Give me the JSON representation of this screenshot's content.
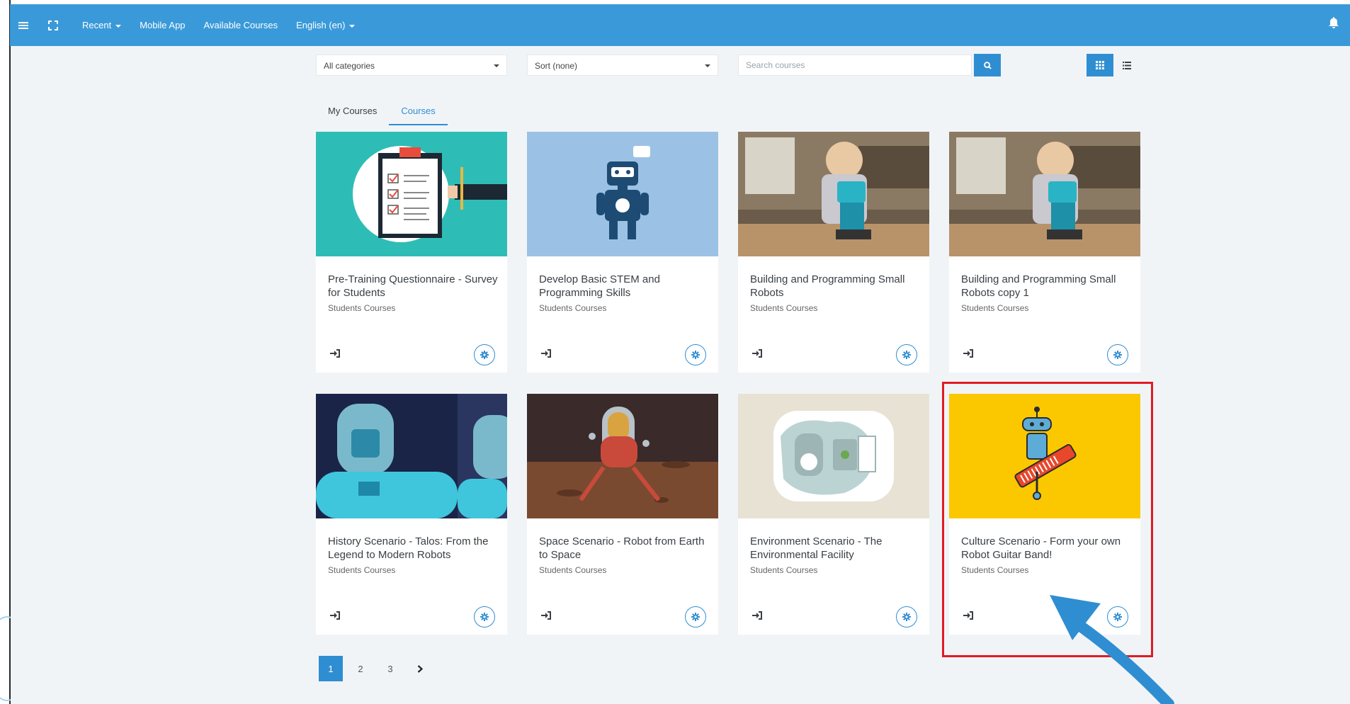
{
  "navbar": {
    "menu_icon": "hamburger-icon",
    "fullscreen_icon": "fullscreen-icon",
    "recent_label": "Recent",
    "mobile_app_label": "Mobile App",
    "available_courses_label": "Available Courses",
    "language_label": "English (en)",
    "bell_icon": "bell-icon"
  },
  "filters": {
    "category_value": "All categories",
    "sort_value": "Sort (none)",
    "search_placeholder": "Search courses",
    "search_icon": "search-icon",
    "grid_view_icon": "grid-view-icon",
    "list_view_icon": "list-view-icon"
  },
  "tabs": [
    {
      "label": "My Courses",
      "active": false
    },
    {
      "label": "Courses",
      "active": true
    }
  ],
  "courses": [
    {
      "title": "Pre-Training Questionnaire - Survey for Students",
      "category": "Students Courses",
      "image": "clipboard-checklist"
    },
    {
      "title": "Develop Basic STEM and Programming Skills",
      "category": "Students Courses",
      "image": "blue-robot-hi"
    },
    {
      "title": "Building and Programming Small Robots",
      "category": "Students Courses",
      "image": "child-with-robot-photo"
    },
    {
      "title": "Building and Programming Small Robots copy 1",
      "category": "Students Courses",
      "image": "child-with-robot-photo"
    },
    {
      "title": "History Scenario - Talos: From the Legend to Modern Robots",
      "category": "Students Courses",
      "image": "cyan-robots"
    },
    {
      "title": "Space Scenario - Robot from Earth to Space",
      "category": "Students Courses",
      "image": "space-robot-on-mars"
    },
    {
      "title": "Environment Scenario - The Environmental Facility",
      "category": "Students Courses",
      "image": "environmental-facility"
    },
    {
      "title": "Culture Scenario - Form your own Robot Guitar Band!",
      "category": "Students Courses",
      "image": "robot-with-keytar"
    }
  ],
  "pagination": {
    "pages": [
      "1",
      "2",
      "3"
    ],
    "current": "1",
    "next_icon": "chevron-right-icon"
  },
  "colors": {
    "navbar": "#3a9ad9",
    "accent": "#2f8ed2",
    "background": "#f1f4f7",
    "highlight": "#e01b24"
  }
}
